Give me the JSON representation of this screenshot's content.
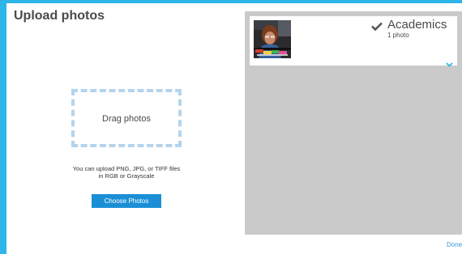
{
  "colors": {
    "accent": "#2eb5ea",
    "button": "#1a8fd6",
    "link": "#3a9bd9",
    "panel": "#cacaca",
    "dropzone_border": "#b3d4ee"
  },
  "dialog": {
    "title": "Upload photos"
  },
  "dropzone": {
    "label": "Drag photos",
    "hint_line1": "You can upload PNG, JPG, or TIFF files",
    "hint_line2": "in RGB or Grayscale"
  },
  "choose_button": {
    "label": "Choose Photos"
  },
  "album": {
    "name": "Academics",
    "count": "1 photo",
    "selected": true,
    "check_icon": "checkmark-icon",
    "expand_icon": "chevron-down-icon"
  },
  "footer": {
    "done_label": "Done"
  }
}
